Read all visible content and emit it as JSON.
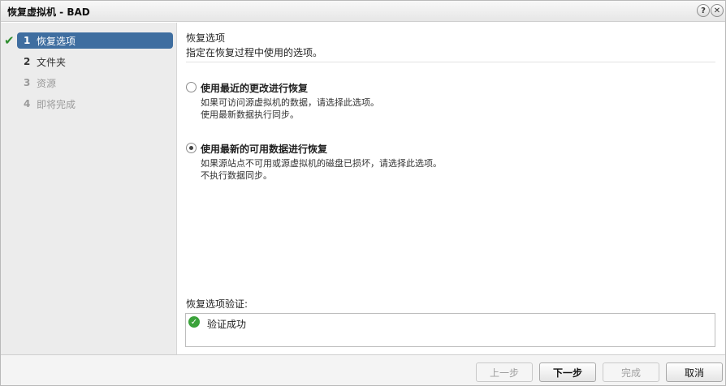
{
  "window": {
    "title": "恢复虚拟机 - BAD",
    "help_glyph": "?",
    "close_glyph": "✕"
  },
  "sidebar": {
    "check_glyph": "✔",
    "steps": [
      {
        "num": "1",
        "label": "恢复选项"
      },
      {
        "num": "2",
        "label": "文件夹"
      },
      {
        "num": "3",
        "label": "资源"
      },
      {
        "num": "4",
        "label": "即将完成"
      }
    ]
  },
  "content": {
    "title": "恢复选项",
    "description": "指定在恢复过程中使用的选项。",
    "options": [
      {
        "title": "使用最近的更改进行恢复",
        "desc_line1": "如果可访问源虚拟机的数据，请选择此选项。",
        "desc_line2": "使用最新数据执行同步。",
        "checked": false
      },
      {
        "title": "使用最新的可用数据进行恢复",
        "desc_line1": "如果源站点不可用或源虚拟机的磁盘已损坏，请选择此选项。",
        "desc_line2": "不执行数据同步。",
        "checked": true
      }
    ],
    "validation": {
      "label": "恢复选项验证:",
      "status_glyph": "✓",
      "status_text": "验证成功"
    }
  },
  "footer": {
    "back_label": "上一步",
    "next_label": "下一步",
    "finish_label": "完成",
    "cancel_label": "取消"
  },
  "colors": {
    "active_step": "#3f6ea0",
    "success": "#3aa23a"
  }
}
